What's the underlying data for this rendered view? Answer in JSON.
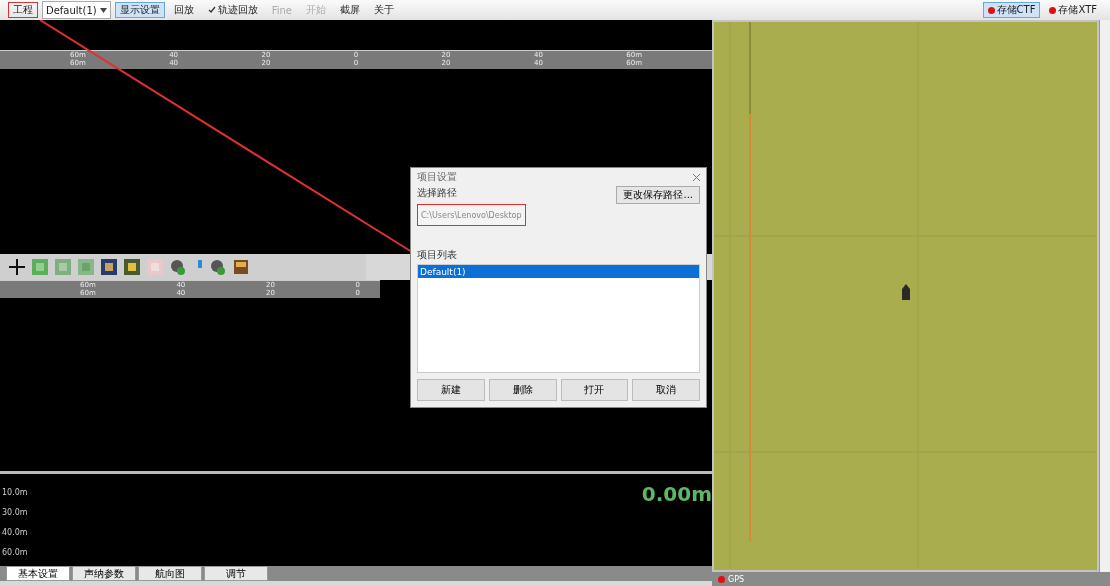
{
  "toolbar": {
    "items": [
      {
        "kind": "button",
        "label": "工程",
        "selected": false,
        "highlighted": true
      },
      {
        "kind": "dropdown",
        "label": "Default(1)"
      },
      {
        "kind": "button",
        "label": "显示设置",
        "selected": true,
        "highlighted": false
      },
      {
        "kind": "button",
        "label": "回放",
        "selected": false,
        "highlighted": false
      },
      {
        "kind": "check",
        "label": "轨迹回放",
        "selected": false,
        "highlighted": false
      },
      {
        "kind": "disabled",
        "label": "Fine",
        "selected": false,
        "highlighted": false
      },
      {
        "kind": "disabled",
        "label": "开始",
        "selected": false,
        "highlighted": false
      },
      {
        "kind": "button",
        "label": "截屏",
        "selected": false,
        "highlighted": false
      },
      {
        "kind": "button",
        "label": "关于",
        "selected": false,
        "highlighted": false
      }
    ],
    "right": [
      {
        "label": "存储CTF",
        "selected": true,
        "color": "#e01010"
      },
      {
        "label": "存储XTF",
        "selected": false,
        "color": "#e01010"
      }
    ]
  },
  "top_ruler": [
    [
      "60m",
      "60m"
    ],
    [
      "40",
      "40"
    ],
    [
      "20",
      "20"
    ],
    [
      "0",
      "0"
    ],
    [
      "20",
      "20"
    ],
    [
      "40",
      "40"
    ],
    [
      "60m",
      "60m"
    ]
  ],
  "lower_ruler": [
    [
      "60m",
      "60m"
    ],
    [
      "40",
      "40"
    ],
    [
      "20",
      "20"
    ],
    [
      "0",
      "0"
    ]
  ],
  "depth": {
    "labels": [
      "10.0m",
      "30.0m",
      "40.0m",
      "60.0m"
    ],
    "reading": "0.00m"
  },
  "bottom_tabs": [
    {
      "label": "基本设置",
      "selected": true
    },
    {
      "label": "声纳参数",
      "selected": false
    },
    {
      "label": "航向图",
      "selected": false
    },
    {
      "label": "调节",
      "selected": false
    }
  ],
  "status": {
    "label": "GPS",
    "color": "#e01010"
  },
  "dialog": {
    "title": "项目设置",
    "path_label": "选择路径",
    "path": "C:\\Users\\Lenovo\\Desktop",
    "change_button": "更改保存路径...",
    "list_label": "项目列表",
    "projects": [
      {
        "name": "Default(1)",
        "selected": true
      }
    ],
    "buttons": [
      "新建",
      "删除",
      "打开",
      "取消"
    ]
  }
}
